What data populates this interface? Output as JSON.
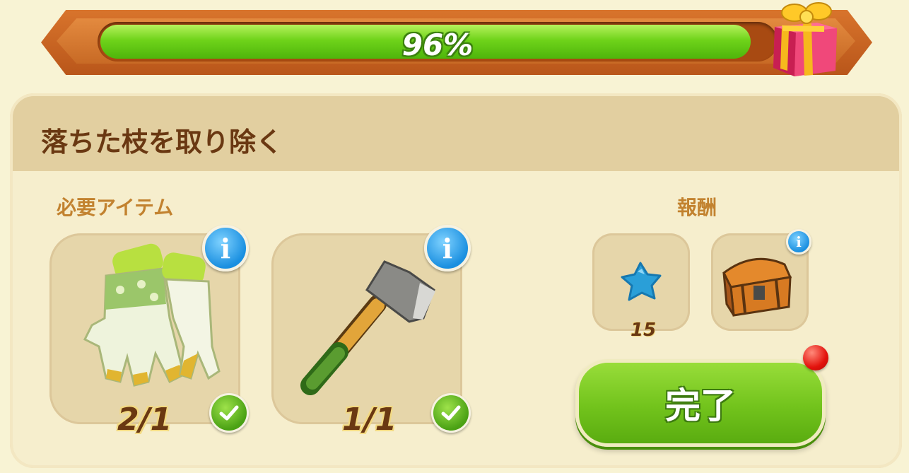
{
  "progress": {
    "value": 0.96,
    "label": "96%",
    "reward_icon": "gift-box-icon"
  },
  "task": {
    "title": "落ちた枝を取り除く"
  },
  "required": {
    "label": "必要アイテム",
    "items": [
      {
        "name": "gloves",
        "icon": "gloves-icon",
        "count": "2/1",
        "completed": true
      },
      {
        "name": "axe",
        "icon": "axe-icon",
        "count": "1/1",
        "completed": true
      }
    ]
  },
  "rewards": {
    "label": "報酬",
    "items": [
      {
        "icon": "blue-star-icon",
        "count": "15"
      },
      {
        "icon": "treasure-chest-icon"
      }
    ]
  },
  "complete_button": {
    "label": "完了",
    "notification": true
  },
  "colors": {
    "accent_green": "#6fd31a",
    "frame_orange": "#c86a25",
    "title_brown": "#6a3812"
  }
}
